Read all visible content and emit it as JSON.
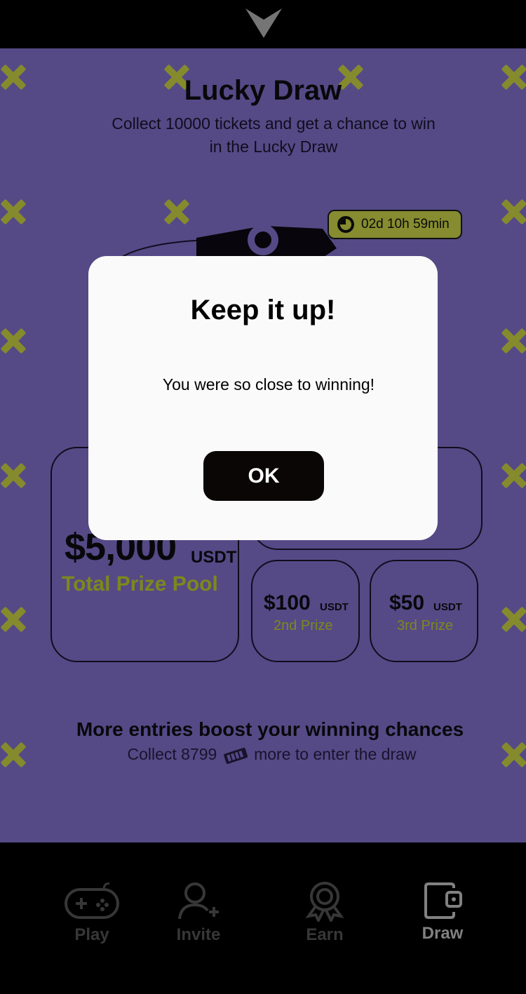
{
  "header": {
    "title": "Lucky Draw",
    "subtitle": "Collect 10000 tickets and get a chance to win in the Lucky Draw"
  },
  "timer": {
    "text": "02d 10h 59min"
  },
  "prizes": {
    "pool_amount": "$5,000",
    "pool_unit": "USDT",
    "pool_label": "Total Prize Pool",
    "second": {
      "amount": "$100",
      "unit": "USDT",
      "label": "2nd Prize"
    },
    "third": {
      "amount": "$50",
      "unit": "USDT",
      "label": "3rd Prize"
    }
  },
  "boost": {
    "headline": "More entries boost your winning chances",
    "collect_prefix": "Collect 8799",
    "collect_suffix": "more to enter the draw"
  },
  "nav": {
    "items": [
      {
        "label": "Play",
        "icon": "gamepad-icon"
      },
      {
        "label": "Invite",
        "icon": "add-user-icon"
      },
      {
        "label": "Earn",
        "icon": "award-icon"
      },
      {
        "label": "Draw",
        "icon": "wallet-icon"
      }
    ],
    "active": "Draw"
  },
  "modal": {
    "title": "Keep it up!",
    "message": "You were so close to winning!",
    "button": "OK"
  },
  "colors": {
    "background": "#8a78d8",
    "accent": "#d8e24c",
    "modal": "#fafafa",
    "button": "#0a0606"
  }
}
